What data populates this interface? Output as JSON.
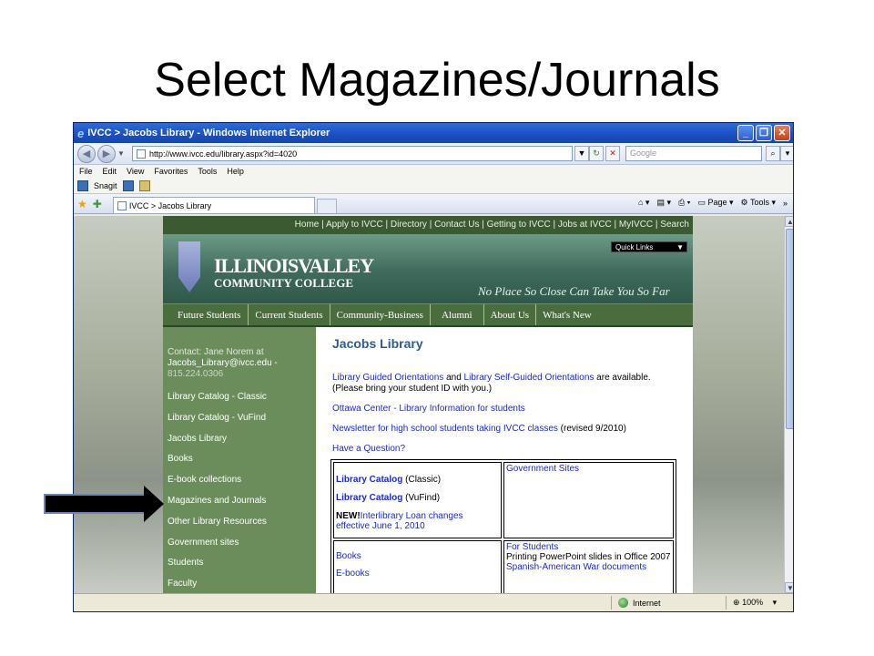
{
  "slide": {
    "title": "Select Magazines/Journals"
  },
  "window": {
    "title": "IVCC > Jacobs Library - Windows Internet Explorer",
    "address": "http://www.ivcc.edu/library.aspx?id=4020",
    "search_placeholder": "Google",
    "menu": [
      "File",
      "Edit",
      "View",
      "Favorites",
      "Tools",
      "Help"
    ],
    "snagit_label": "Snagit",
    "tab_label": "IVCC > Jacobs Library",
    "cmd_page": "Page",
    "cmd_tools": "Tools",
    "status_zone": "Internet",
    "status_zoom": "100%"
  },
  "site": {
    "toplinks": "Home | Apply to IVCC | Directory | Contact Us | Getting to IVCC | Jobs at IVCC | MyIVCC | Search",
    "logo_line1": "ILLINOISVALLEY",
    "logo_line2": "COMMUNITY COLLEGE",
    "tagline": "No Place So Close Can Take You So Far",
    "quick_links": "Quick Links",
    "nav": [
      "Future Students",
      "Current Students",
      "Community-Business",
      "Alumni",
      "About Us",
      "What's New"
    ],
    "contact_line1": "Contact: Jane Norem at",
    "contact_line2": "Jacobs_Library@ivcc.edu -",
    "contact_line3": "815.224.0306",
    "left_links": [
      "Library Catalog - Classic",
      "Library Catalog - VuFind",
      "Jacobs Library",
      "Books",
      "E-book collections",
      "Magazines and Journals",
      "Other Library Resources",
      "Government sites",
      "Students",
      "Faculty"
    ],
    "heading": "Jacobs Library",
    "p1_link1": "Library Guided Orientations",
    "p1_and": " and ",
    "p1_link2": "Library Self-Guided Orientations",
    "p1_tail": " are available.",
    "p1_line2": "(Please bring your student ID with you.)",
    "p2_link": "Ottawa Center - Library Information for students",
    "p3_link": "Newsletter for high school students taking IVCC classes",
    "p3_tail": " (revised 9/2010)",
    "p4_link": "Have a Question?",
    "table": {
      "catalog_classic": "Library Catalog",
      "catalog_classic_tail": " (Classic)",
      "catalog_vufind": "Library Catalog",
      "catalog_vufind_tail": " (VuFind)",
      "new_label": "NEW!",
      "ill_link": "Interlibrary Loan changes effective June 1, 2010",
      "gov_sites": "Government Sites",
      "books": "Books",
      "ebooks": "E-books",
      "for_students": "For Students",
      "ppt_text": "Printing PowerPoint slides in Office 2007",
      "war_docs": "Spanish-American War documents"
    }
  }
}
